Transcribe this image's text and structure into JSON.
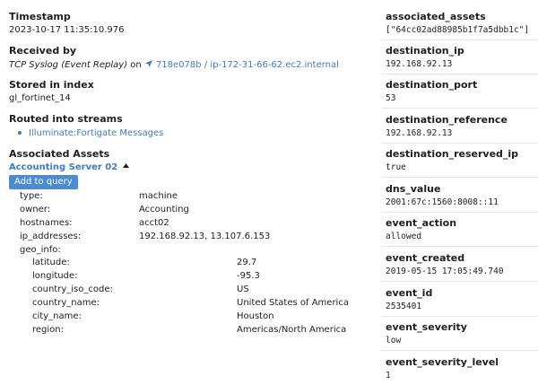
{
  "left": {
    "timestamp": {
      "label": "Timestamp",
      "value": "2023-10-17 11:35:10.976"
    },
    "received_by": {
      "label": "Received by",
      "source": "TCP Syslog (Event Replay)",
      "on": " on ",
      "node": "718e078b / ip-172-31-66-62.ec2.internal"
    },
    "stored": {
      "label": "Stored in index",
      "value": "gl_fortinet_14"
    },
    "routed": {
      "label": "Routed into streams",
      "stream": "Illuminate:Fortigate Messages"
    },
    "assets": {
      "label": "Associated Assets",
      "asset_name": "Accounting Server 02",
      "add_to_query": "Add to query",
      "fields": [
        {
          "key": "type:",
          "value": "machine"
        },
        {
          "key": "owner:",
          "value": "Accounting"
        },
        {
          "key": "hostnames:",
          "value": "acct02"
        },
        {
          "key": "ip_addresses:",
          "value": "192.168.92.13, 13.107.6.153"
        },
        {
          "key": "geo_info:",
          "value": ""
        }
      ],
      "geo": [
        {
          "key": "latitude:",
          "value": "29.7"
        },
        {
          "key": "longitude:",
          "value": "-95.3"
        },
        {
          "key": "country_iso_code:",
          "value": "US"
        },
        {
          "key": "country_name:",
          "value": "United States of America"
        },
        {
          "key": "city_name:",
          "value": "Houston"
        },
        {
          "key": "region:",
          "value": "Americas/North America"
        }
      ]
    }
  },
  "right": [
    {
      "label": "associated_assets",
      "value": "[\"64cc02ad88985b1f7a5dbb1c\"]"
    },
    {
      "label": "destination_ip",
      "value": "192.168.92.13"
    },
    {
      "label": "destination_port",
      "value": "53"
    },
    {
      "label": "destination_reference",
      "value": "192.168.92.13"
    },
    {
      "label": "destination_reserved_ip",
      "value": "true"
    },
    {
      "label": "dns_value",
      "value": "2001:67c:1560:8008::11"
    },
    {
      "label": "event_action",
      "value": "allowed"
    },
    {
      "label": "event_created",
      "value": "2019-05-15 17:05:49.740"
    },
    {
      "label": "event_id",
      "value": "2535401"
    },
    {
      "label": "event_severity",
      "value": "low"
    },
    {
      "label": "event_severity_level",
      "value": "1"
    }
  ]
}
